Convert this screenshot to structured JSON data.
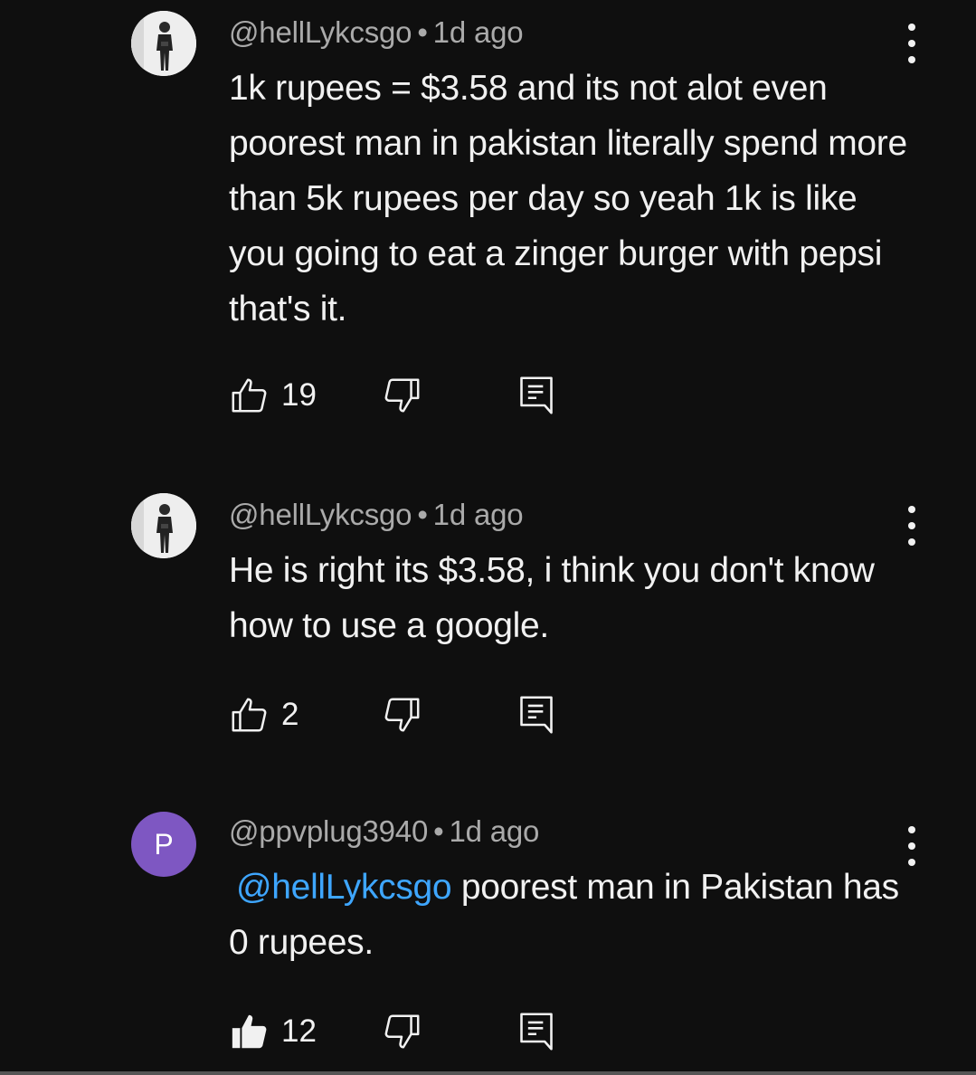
{
  "comments": [
    {
      "author": "@hellLykcsgo",
      "separator": "•",
      "time": "1d ago",
      "avatar": "photo",
      "mention": "",
      "text": "1k rupees = $3.58 and its not alot even poorest man in pakistan literally spend more than 5k rupees per day so yeah 1k is like you going to eat a zinger burger with pepsi that's it.",
      "likes": "19",
      "liked": false
    },
    {
      "author": "@hellLykcsgo",
      "separator": "•",
      "time": "1d ago",
      "avatar": "photo",
      "mention": "",
      "text": "He is right its $3.58, i think you don't know how to use a google.",
      "likes": "2",
      "liked": false
    },
    {
      "author": "@ppvplug3940",
      "separator": "•",
      "time": "1d ago",
      "avatar": "letter",
      "avatar_letter": "P",
      "mention": "@hellLykcsgo",
      "text": "poorest man in Pakistan has 0 rupees.",
      "likes": "12",
      "liked": true
    }
  ],
  "icons": {
    "like": "thumbs-up-icon",
    "dislike": "thumbs-down-icon",
    "reply": "reply-comment-icon",
    "menu": "more-vertical-icon"
  },
  "colors": {
    "background": "#0f0f0f",
    "text": "#f1f1f1",
    "meta": "#aaaaaa",
    "mention": "#3ea6ff",
    "avatar_letter_bg": "#7e57c2"
  }
}
